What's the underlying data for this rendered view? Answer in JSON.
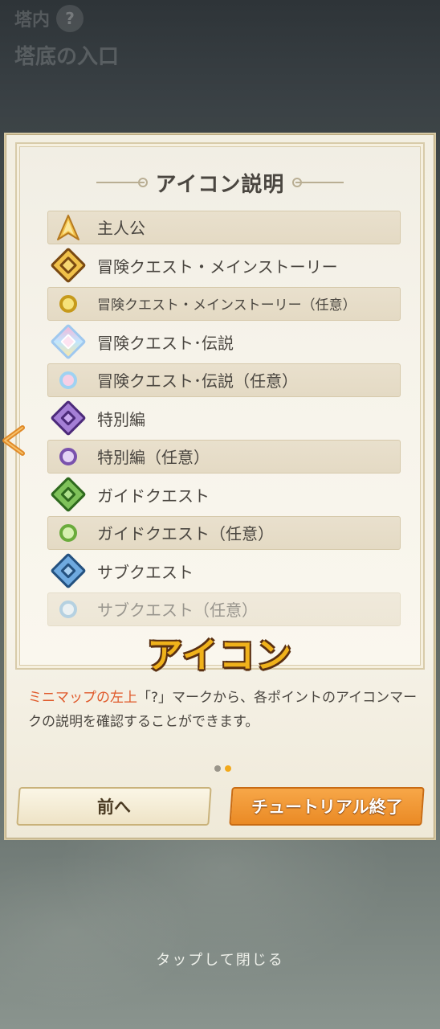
{
  "background": {
    "area_label": "塔内",
    "area_help_icon": "question-icon",
    "location_name": "塔底の入口"
  },
  "modal": {
    "title": "アイコン説明",
    "rows": [
      {
        "label": "主人公",
        "icon": "player-arrow-icon",
        "boxed": true
      },
      {
        "label": "冒険クエスト・メインストーリー",
        "icon": "main-story-diamond-icon",
        "boxed": false
      },
      {
        "label": "冒険クエスト・メインストーリー（任意）",
        "icon": "main-story-ring-icon",
        "boxed": true
      },
      {
        "label": "冒険クエスト･伝説",
        "icon": "legend-diamond-icon",
        "boxed": false
      },
      {
        "label": "冒険クエスト･伝説（任意）",
        "icon": "legend-ring-icon",
        "boxed": true
      },
      {
        "label": "特別編",
        "icon": "special-diamond-icon",
        "boxed": false
      },
      {
        "label": "特別編（任意）",
        "icon": "special-ring-icon",
        "boxed": true
      },
      {
        "label": "ガイドクエスト",
        "icon": "guide-diamond-icon",
        "boxed": false
      },
      {
        "label": "ガイドクエスト（任意）",
        "icon": "guide-ring-icon",
        "boxed": true
      },
      {
        "label": "サブクエスト",
        "icon": "sub-diamond-icon",
        "boxed": false
      },
      {
        "label": "サブクエスト（任意）",
        "icon": "sub-ring-icon",
        "boxed": true
      }
    ],
    "big_label": "アイコン",
    "description_highlight": "ミニマップの左上",
    "description_rest": "「?」マークから、各ポイントのアイコンマークの説明を確認することができます。",
    "pager": {
      "current": 2,
      "total": 2
    },
    "prev_button": "前へ",
    "end_button": "チュートリアル終了",
    "colors": {
      "accent_orange": "#ea8a25",
      "highlight": "#e0592a",
      "main_story": "#b8791f",
      "special": "#7a4bb3",
      "guide": "#5e9e3a",
      "sub": "#4a86c2"
    }
  },
  "close_hint": "タップして閉じる"
}
